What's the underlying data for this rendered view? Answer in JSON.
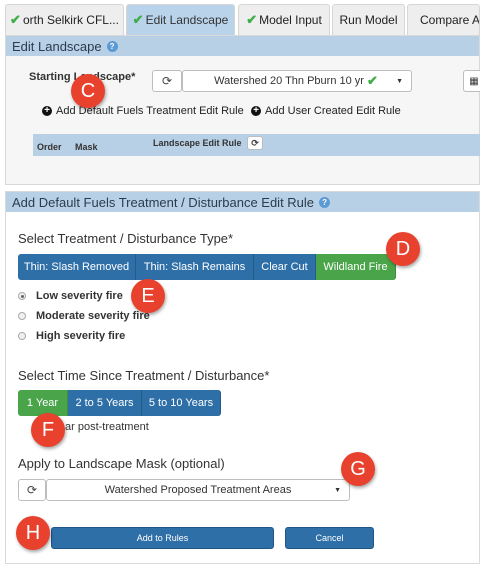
{
  "tabs": [
    {
      "label": "orth Selkirk CFL...",
      "checked": true
    },
    {
      "label": "Edit Landscape",
      "checked": true
    },
    {
      "label": "Model Input",
      "checked": true
    },
    {
      "label": "Run Model",
      "checked": false
    },
    {
      "label": "Compare Alte",
      "checked": false
    }
  ],
  "edit_landscape": {
    "title": "Edit Landscape",
    "starting_landscape_label": "Starting Landscape*",
    "starting_landscape_value": "Watershed 20 Thn Pburn 10 yr",
    "add_default_rule": "Add Default Fuels Treatment Edit Rule",
    "add_user_rule": "Add User Created Edit Rule",
    "table_headers": {
      "order": "Order",
      "mask": "Mask",
      "rule": "Landscape Edit Rule"
    }
  },
  "add_rule": {
    "title": "Add Default Fuels Treatment / Disturbance Edit Rule",
    "treatment_heading": "Select Treatment / Disturbance Type*",
    "treatment_types": [
      "Thin: Slash Removed",
      "Thin: Slash Remains",
      "Clear Cut",
      "Wildland Fire"
    ],
    "severity_options": [
      "Low severity fire",
      "Moderate severity fire",
      "High severity fire"
    ],
    "time_heading": "Select Time Since Treatment / Disturbance*",
    "time_options": [
      "1 Year",
      "2 to 5 Years",
      "5 to 10 Years"
    ],
    "time_note": "ar post-treatment",
    "mask_heading": "Apply to Landscape Mask (optional)",
    "mask_value": "Watershed Proposed Treatment Areas",
    "add_button": "Add to Rules",
    "cancel_button": "Cancel"
  },
  "markers": [
    "C",
    "D",
    "E",
    "F",
    "G",
    "H"
  ],
  "colors": {
    "header_blue": "#b8d0e6",
    "button_blue": "#2e6fa8",
    "selected_green": "#4aa54a",
    "marker_red": "#e8412d",
    "check_green": "#3fae49"
  },
  "icons": [
    "check-icon",
    "info-icon",
    "refresh-icon",
    "caret-down-icon",
    "plus-circle-icon",
    "grid-icon"
  ]
}
